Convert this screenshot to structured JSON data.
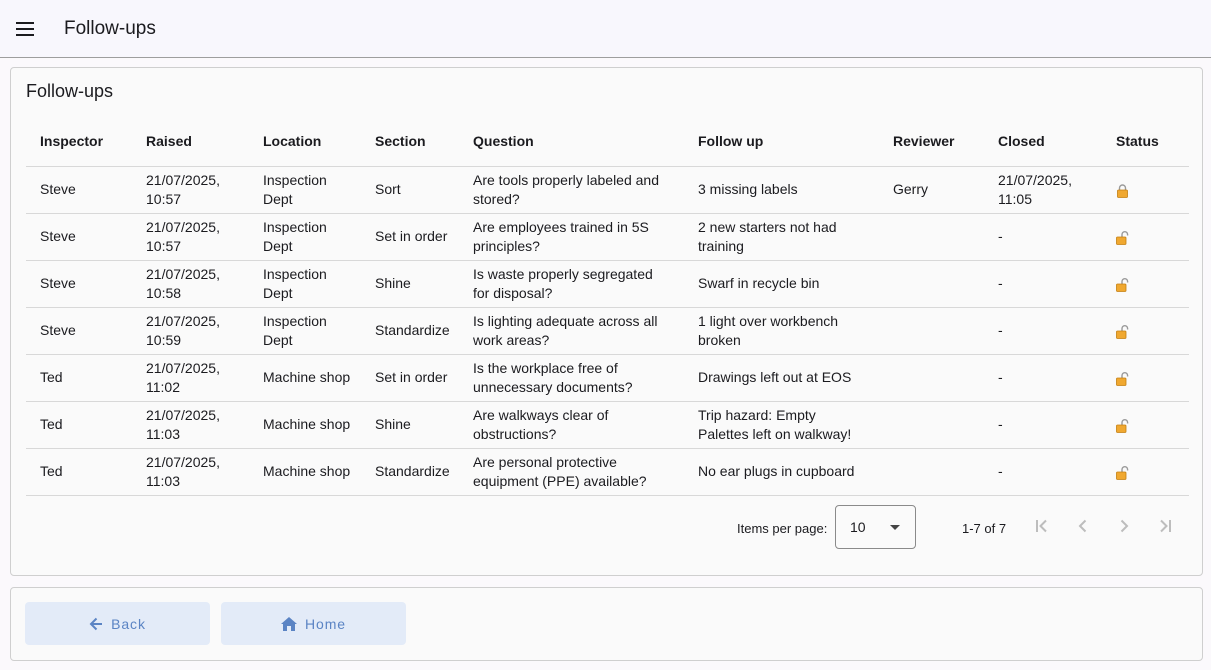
{
  "toolbar": {
    "title": "Follow-ups",
    "menu_icon": "menu-icon"
  },
  "card": {
    "title": "Follow-ups"
  },
  "table": {
    "headers": {
      "inspector": "Inspector",
      "raised": "Raised",
      "location": "Location",
      "section": "Section",
      "question": "Question",
      "follow_up": "Follow up",
      "reviewer": "Reviewer",
      "closed": "Closed",
      "status": "Status"
    },
    "rows": [
      {
        "inspector": "Steve",
        "raised": "21/07/2025, 10:57",
        "location": "Inspection Dept",
        "section": "Sort",
        "question": "Are tools properly labeled and stored?",
        "follow_up": "3 missing labels",
        "reviewer": "Gerry",
        "closed": "21/07/2025, 11:05",
        "status": "locked"
      },
      {
        "inspector": "Steve",
        "raised": "21/07/2025, 10:57",
        "location": "Inspection Dept",
        "section": "Set in order",
        "question": "Are employees trained in 5S principles?",
        "follow_up": "2 new starters not had training",
        "reviewer": "",
        "closed": "-",
        "status": "unlocked"
      },
      {
        "inspector": "Steve",
        "raised": "21/07/2025, 10:58",
        "location": "Inspection Dept",
        "section": "Shine",
        "question": "Is waste properly segregated for disposal?",
        "follow_up": "Swarf in recycle bin",
        "reviewer": "",
        "closed": "-",
        "status": "unlocked"
      },
      {
        "inspector": "Steve",
        "raised": "21/07/2025, 10:59",
        "location": "Inspection Dept",
        "section": "Standardize",
        "question": "Is lighting adequate across all work areas?",
        "follow_up": "1 light over workbench broken",
        "reviewer": "",
        "closed": "-",
        "status": "unlocked"
      },
      {
        "inspector": "Ted",
        "raised": "21/07/2025, 11:02",
        "location": "Machine shop",
        "section": "Set in order",
        "question": "Is the workplace free of unnecessary documents?",
        "follow_up": "Drawings left out at EOS",
        "reviewer": "",
        "closed": "-",
        "status": "unlocked"
      },
      {
        "inspector": "Ted",
        "raised": "21/07/2025, 11:03",
        "location": "Machine shop",
        "section": "Shine",
        "question": "Are walkways clear of obstructions?",
        "follow_up": "Trip hazard: Empty Palettes left on walkway!",
        "reviewer": "",
        "closed": "-",
        "status": "unlocked"
      },
      {
        "inspector": "Ted",
        "raised": "21/07/2025, 11:03",
        "location": "Machine shop",
        "section": "Standardize",
        "question": "Are personal protective equipment (PPE) available?",
        "follow_up": "No ear plugs in cupboard",
        "reviewer": "",
        "closed": "-",
        "status": "unlocked"
      }
    ]
  },
  "paginator": {
    "items_per_page_label": "Items per page:",
    "items_per_page_value": "10",
    "range_label": "1-7 of 7"
  },
  "buttons": {
    "back_label": "Back",
    "home_label": "Home"
  },
  "colors": {
    "lock_fill": "#f0a830",
    "button_bg": "#e3ebf8",
    "button_text": "#5b84c4"
  }
}
